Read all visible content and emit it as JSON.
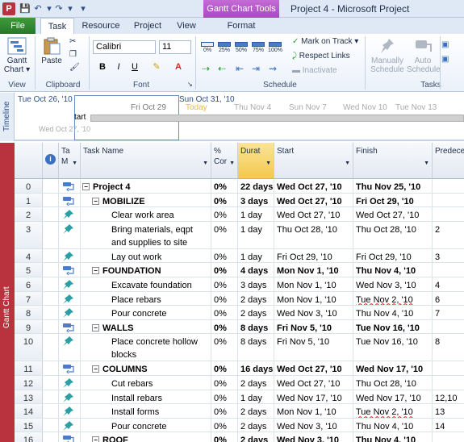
{
  "window": {
    "app_icon": "P",
    "context_tab": "Gantt Chart Tools",
    "title": "Project 4  -  Microsoft Project"
  },
  "tabs": [
    "File",
    "Task",
    "Resource",
    "Project",
    "View",
    "Format"
  ],
  "ribbon": {
    "view_group": {
      "gantt_label": "Gantt Chart ▾",
      "label": "View"
    },
    "clipboard_group": {
      "paste_label": "Paste",
      "label": "Clipboard"
    },
    "font_group": {
      "font_name": "Calibri",
      "font_size": "11",
      "label": "Font",
      "bold": "B",
      "italic": "I",
      "underline": "U"
    },
    "schedule_group": {
      "percents": [
        "0%",
        "25%",
        "50%",
        "75%",
        "100%"
      ],
      "mark_on_track": "Mark on Track",
      "respect_links": "Respect Links",
      "inactivate": "Inactivate",
      "label": "Schedule"
    },
    "tasks_group": {
      "manually": "Manually Schedule",
      "auto": "Auto Schedule",
      "label": "Tasks"
    }
  },
  "timeline": {
    "side_label": "Timeline",
    "start_top": "Tue Oct 26, '10",
    "start_bottom": "Wed Oct 27, '10",
    "today": "Today",
    "sun_oct31": "Sun Oct 31, '10",
    "ticks": [
      "Fri Oct 29",
      "Thu Nov 4",
      "Sun Nov 7",
      "Wed Nov 10",
      "Tue Nov 13"
    ],
    "bar_label": "tart"
  },
  "sheet": {
    "side_label": "Gantt Chart",
    "headers": {
      "info": "i",
      "mode": "Ta M",
      "name": "Task Name",
      "complete": "% Cor",
      "duration": "Durat",
      "start": "Start",
      "finish": "Finish",
      "predecessors": "Predeces"
    },
    "rows": [
      {
        "id": "0",
        "mode": "auto",
        "name": "Project 4",
        "level": 0,
        "summary": true,
        "pct": "0%",
        "dur": "22 days",
        "start": "Wed Oct 27, '10",
        "finish": "Thu Nov 25, '10",
        "pred": ""
      },
      {
        "id": "1",
        "mode": "auto",
        "name": "MOBILIZE",
        "level": 1,
        "summary": true,
        "pct": "0%",
        "dur": "3 days",
        "start": "Wed Oct 27, '10",
        "finish": "Fri Oct 29, '10",
        "pred": ""
      },
      {
        "id": "2",
        "mode": "manual",
        "name": "Clear work area",
        "level": 2,
        "summary": false,
        "pct": "0%",
        "dur": "1 day",
        "start": "Wed Oct 27, '10",
        "finish": "Wed Oct 27, '10",
        "pred": ""
      },
      {
        "id": "3",
        "mode": "manual",
        "name": "Bring materials, eqpt and supplies to site",
        "level": 2,
        "summary": false,
        "pct": "0%",
        "dur": "1 day",
        "start": "Thu Oct 28, '10",
        "finish": "Thu Oct 28, '10",
        "pred": "2"
      },
      {
        "id": "4",
        "mode": "manual",
        "name": "Lay out work",
        "level": 2,
        "summary": false,
        "pct": "0%",
        "dur": "1 day",
        "start": "Fri Oct 29, '10",
        "finish": "Fri Oct 29, '10",
        "pred": "3"
      },
      {
        "id": "5",
        "mode": "auto",
        "name": "FOUNDATION",
        "level": 1,
        "summary": true,
        "pct": "0%",
        "dur": "4 days",
        "start": "Mon Nov 1, '10",
        "finish": "Thu Nov 4, '10",
        "pred": ""
      },
      {
        "id": "6",
        "mode": "manual",
        "name": "Excavate foundation",
        "level": 2,
        "summary": false,
        "pct": "0%",
        "dur": "3 days",
        "start": "Mon Nov 1, '10",
        "finish": "Wed Nov 3, '10",
        "pred": "4"
      },
      {
        "id": "7",
        "mode": "manual",
        "name": "Place rebars",
        "level": 2,
        "summary": false,
        "pct": "0%",
        "dur": "2 days",
        "start": "Mon Nov 1, '10",
        "finish": "Tue Nov 2, '10",
        "pred": "6",
        "finish_warn": true
      },
      {
        "id": "8",
        "mode": "manual",
        "name": "Pour concrete",
        "level": 2,
        "summary": false,
        "pct": "0%",
        "dur": "2 days",
        "start": "Wed Nov 3, '10",
        "finish": "Thu Nov 4, '10",
        "pred": "7"
      },
      {
        "id": "9",
        "mode": "auto",
        "name": "WALLS",
        "level": 1,
        "summary": true,
        "pct": "0%",
        "dur": "8 days",
        "start": "Fri Nov 5, '10",
        "finish": "Tue Nov 16, '10",
        "pred": ""
      },
      {
        "id": "10",
        "mode": "manual",
        "name": "Place concrete hollow blocks",
        "level": 2,
        "summary": false,
        "pct": "0%",
        "dur": "8 days",
        "start": "Fri Nov 5, '10",
        "finish": "Tue Nov 16, '10",
        "pred": "8"
      },
      {
        "id": "11",
        "mode": "auto",
        "name": "COLUMNS",
        "level": 1,
        "summary": true,
        "pct": "0%",
        "dur": "16 days",
        "start": "Wed Oct 27, '10",
        "finish": "Wed Nov 17, '10",
        "pred": ""
      },
      {
        "id": "12",
        "mode": "manual",
        "name": "Cut rebars",
        "level": 2,
        "summary": false,
        "pct": "0%",
        "dur": "2 days",
        "start": "Wed Oct 27, '10",
        "finish": "Thu Oct 28, '10",
        "pred": ""
      },
      {
        "id": "13",
        "mode": "manual",
        "name": "Install rebars",
        "level": 2,
        "summary": false,
        "pct": "0%",
        "dur": "1 day",
        "start": "Wed Nov 17, '10",
        "finish": "Wed Nov 17, '10",
        "pred": "12,10"
      },
      {
        "id": "14",
        "mode": "manual",
        "name": "Install forms",
        "level": 2,
        "summary": false,
        "pct": "0%",
        "dur": "2 days",
        "start": "Mon Nov 1, '10",
        "finish": "Tue Nov 2, '10",
        "pred": "13",
        "finish_warn": true
      },
      {
        "id": "15",
        "mode": "manual",
        "name": "Pour concrete",
        "level": 2,
        "summary": false,
        "pct": "0%",
        "dur": "2 days",
        "start": "Wed Nov 3, '10",
        "finish": "Thu Nov 4, '10",
        "pred": "14"
      },
      {
        "id": "16",
        "mode": "auto",
        "name": "ROOF",
        "level": 1,
        "summary": true,
        "pct": "0%",
        "dur": "2 days",
        "start": "Wed Nov 3, '10",
        "finish": "Thu Nov 4, '10",
        "pred": ""
      }
    ]
  },
  "colors": {
    "duration_header": "#f7d66b",
    "file_tab": "#2f8a33",
    "context_tab": "#b35ac8",
    "sheet_side": "#b8333e"
  }
}
